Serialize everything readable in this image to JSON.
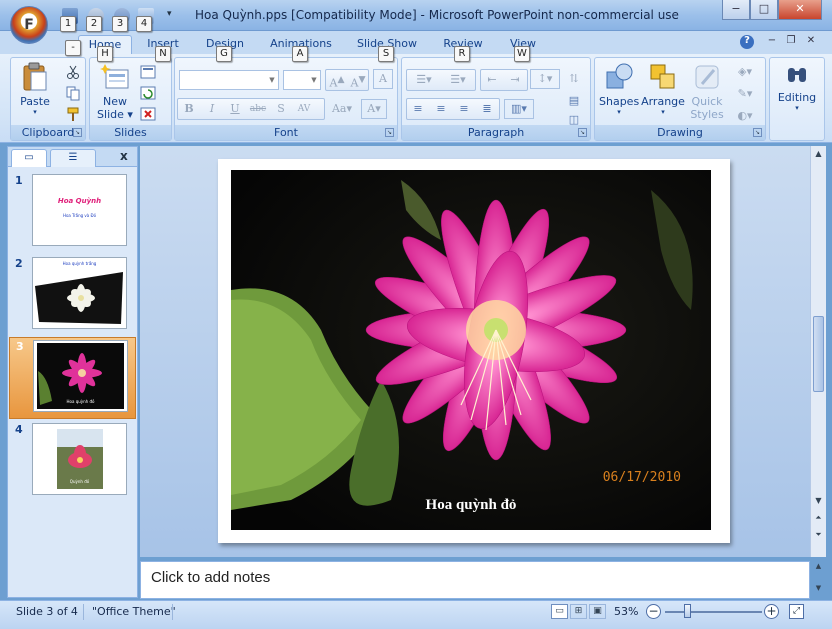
{
  "window": {
    "title": "Hoa Quỳnh.pps [Compatibility Mode] - Microsoft PowerPoint non-commercial use",
    "office_button_keytip": "F",
    "qat_keytips": [
      "1",
      "2",
      "3",
      "4"
    ],
    "minimize": "−",
    "maximize": "□",
    "close": "✕"
  },
  "tabs": [
    {
      "label": "Home",
      "keytip": "H"
    },
    {
      "label": "Insert",
      "keytip": "N"
    },
    {
      "label": "Design",
      "keytip": "G"
    },
    {
      "label": "Animations",
      "keytip": "A"
    },
    {
      "label": "Slide Show",
      "keytip": "S"
    },
    {
      "label": "Review",
      "keytip": "R"
    },
    {
      "label": "View",
      "keytip": "W"
    }
  ],
  "extra_keytip": "-",
  "ribbon": {
    "clipboard": {
      "label": "Clipboard",
      "paste": "Paste"
    },
    "slides": {
      "label": "Slides",
      "new_slide_line1": "New",
      "new_slide_line2": "Slide"
    },
    "font": {
      "label": "Font"
    },
    "paragraph": {
      "label": "Paragraph"
    },
    "drawing": {
      "label": "Drawing",
      "shapes": "Shapes",
      "arrange": "Arrange",
      "quick_styles_line1": "Quick",
      "quick_styles_line2": "Styles"
    },
    "editing": {
      "label": "Editing"
    }
  },
  "slides_panel": {
    "close": "x",
    "slides": [
      {
        "num": "1",
        "title": "Hoa Quỳnh",
        "subtitle": "Hoa Trắng và Đỏ"
      },
      {
        "num": "2",
        "caption": "Hoa quỳnh trắng"
      },
      {
        "num": "3",
        "caption": "Hoa quỳnh đỏ"
      },
      {
        "num": "4",
        "caption": "Quỳnh đỏ"
      }
    ]
  },
  "slide": {
    "date_stamp": "06/17/2010",
    "caption": "Hoa quỳnh đỏ"
  },
  "notes": {
    "placeholder": "Click to add notes"
  },
  "status": {
    "slide_info": "Slide 3 of 4",
    "theme": "\"Office Theme\"",
    "zoom": "53%",
    "zoom_level": 0.53
  },
  "colors": {
    "accent": "#15428b",
    "selected_slide": "#e8963e",
    "flower": "#e0329a"
  }
}
